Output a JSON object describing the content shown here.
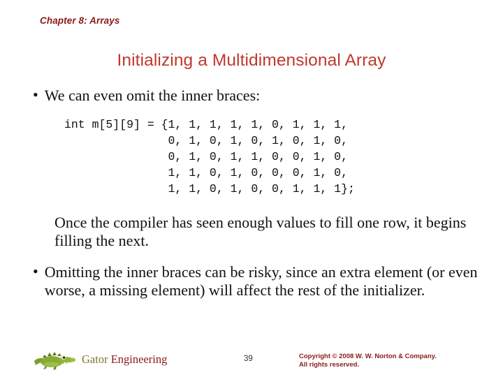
{
  "slide": {
    "chapter_label": "Chapter 8: Arrays",
    "title": "Initializing a Multidimensional Array",
    "bullet1": "We can even omit the inner braces:",
    "code": "int m[5][9] = {1, 1, 1, 1, 1, 0, 1, 1, 1,\n               0, 1, 0, 1, 0, 1, 0, 1, 0,\n               0, 1, 0, 1, 1, 0, 0, 1, 0,\n               1, 1, 0, 1, 0, 0, 0, 1, 0,\n               1, 1, 0, 1, 0, 0, 1, 1, 1};",
    "paragraph": "Once the compiler has seen enough values to fill one row, it begins filling the next.",
    "bullet2": "Omitting the inner braces can be risky, since an extra element (or even worse, a missing element) will affect the rest of the initializer.",
    "bullet_marker": "•"
  },
  "footer": {
    "brand_first": "Gator",
    "brand_second": " Engineering",
    "page_number": "39",
    "copyright_line1": "Copyright © 2008 W. W. Norton & Company.",
    "copyright_line2": "All rights reserved."
  },
  "colors": {
    "chapter": "#8b1a1a",
    "title": "#c0392b",
    "body": "#111111",
    "copyright": "#8b1a1a",
    "gator_green": "#6f8f2a"
  }
}
